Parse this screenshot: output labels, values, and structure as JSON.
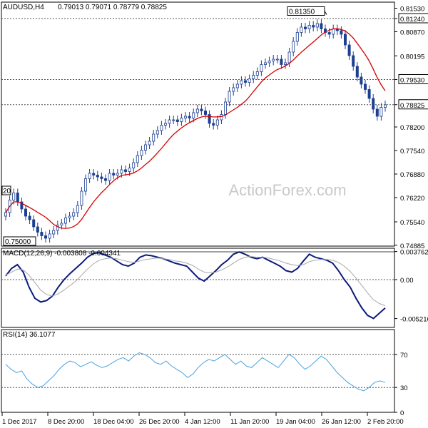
{
  "header": {
    "symbol": "AUDUSD,H4",
    "ohlc": "0.79013 0.79071 0.78779 0.78825"
  },
  "watermark": "ActionForex.com",
  "colors": {
    "candle": "#1d3f91",
    "ma": "#d60000",
    "macd": "#0b1b7a",
    "signal": "#a8a8a8",
    "rsi": "#4aa3df",
    "grid": "#c8c8c8",
    "level": "#555555"
  },
  "chart_data": [
    {
      "type": "candlestick",
      "title": "AUDUSD,H4",
      "ylim": [
        0.7486,
        0.817
      ],
      "yticks": [
        "0.81530",
        "0.81240",
        "0.80870",
        "0.80195",
        "0.79530",
        "0.78825",
        "0.78200",
        "0.77540",
        "0.76880",
        "0.76220",
        "0.75540",
        "0.74885"
      ],
      "xticks": [
        "1 Dec 2017",
        "8 Dec 20:00",
        "18 Dec 04:00",
        "26 Dec 20:00",
        "4 Jan 12:00",
        "11 Jan 20:00",
        "19 Jan 04:00",
        "26 Jan 12:00",
        "2 Feb 20:00"
      ],
      "levels": [
        0.8124,
        0.7953,
        0.78825
      ],
      "level_labels": [
        "0.81240",
        "0.79530",
        "0.78825"
      ],
      "annotations": [
        {
          "text": "0.81350",
          "value": 0.8135
        },
        {
          "text": "0.75000",
          "value": 0.75
        },
        {
          "text": "0.76420",
          "value": 0.7642
        }
      ],
      "annotation_visible_text": {
        "high": "0.81350",
        "low": "0.75000",
        "left": "20"
      },
      "series": [
        {
          "name": "price",
          "close": [
            0.758,
            0.7615,
            0.7635,
            0.761,
            0.759,
            0.757,
            0.756,
            0.754,
            0.7525,
            0.7515,
            0.7508,
            0.752,
            0.753,
            0.7545,
            0.755,
            0.7565,
            0.757,
            0.758,
            0.76,
            0.764,
            0.7675,
            0.769,
            0.7685,
            0.768,
            0.7675,
            0.767,
            0.769,
            0.7685,
            0.769,
            0.77,
            0.7695,
            0.7705,
            0.772,
            0.774,
            0.7755,
            0.777,
            0.778,
            0.78,
            0.781,
            0.7825,
            0.783,
            0.784,
            0.784,
            0.7835,
            0.7845,
            0.785,
            0.7845,
            0.786,
            0.787,
            0.7865,
            0.7855,
            0.783,
            0.7825,
            0.784,
            0.7855,
            0.789,
            0.792,
            0.793,
            0.794,
            0.795,
            0.7945,
            0.7955,
            0.7965,
            0.7975,
            0.7995,
            0.8,
            0.8005,
            0.801,
            0.801,
            0.7995,
            0.8,
            0.803,
            0.806,
            0.8085,
            0.81,
            0.8095,
            0.8105,
            0.81,
            0.811,
            0.8095,
            0.8085,
            0.808,
            0.8095,
            0.809,
            0.808,
            0.805,
            0.802,
            0.799,
            0.796,
            0.794,
            0.7925,
            0.79,
            0.787,
            0.785,
            0.7875,
            0.7882
          ]
        },
        {
          "name": "MA",
          "values": []
        }
      ]
    },
    {
      "type": "line",
      "title": "MACD(12,26,9) -0.003808 -0.004341",
      "ylim": [
        -0.0064,
        0.0042
      ],
      "yticks": [
        "0.003762",
        "0.00",
        "-0.005216"
      ],
      "series": [
        {
          "name": "MACD",
          "values": [
            0.0005,
            0.0015,
            0.002,
            0.001,
            -0.001,
            -0.0025,
            -0.003,
            -0.0028,
            -0.0022,
            -0.001,
            0.0,
            0.0008,
            0.0015,
            0.0022,
            0.003,
            0.0035,
            0.0036,
            0.0033,
            0.003,
            0.0025,
            0.002,
            0.0018,
            0.0022,
            0.003,
            0.0033,
            0.0032,
            0.003,
            0.0028,
            0.0025,
            0.0022,
            0.002,
            0.0018,
            0.001,
            0.0002,
            -0.0002,
            0.0005,
            0.0012,
            0.002,
            0.0026,
            0.0034,
            0.0037,
            0.0034,
            0.003,
            0.0028,
            0.003,
            0.0026,
            0.0022,
            0.0018,
            0.0012,
            0.001,
            0.0015,
            0.0025,
            0.0034,
            0.003,
            0.0028,
            0.0026,
            0.0022,
            0.0012,
            0.0,
            -0.001,
            -0.0025,
            -0.0038,
            -0.0048,
            -0.0052,
            -0.0045,
            -0.0038
          ]
        },
        {
          "name": "Signal",
          "values": [
            0.0006,
            0.001,
            0.0014,
            0.0013,
            0.0006,
            -0.0004,
            -0.0014,
            -0.002,
            -0.0022,
            -0.0019,
            -0.0014,
            -0.0008,
            -0.0002,
            0.0006,
            0.0014,
            0.0021,
            0.0026,
            0.0028,
            0.0029,
            0.0028,
            0.0026,
            0.0024,
            0.0023,
            0.0025,
            0.0027,
            0.0028,
            0.0029,
            0.0028,
            0.0027,
            0.0025,
            0.0024,
            0.0022,
            0.0019,
            0.0014,
            0.001,
            0.0009,
            0.001,
            0.0013,
            0.0017,
            0.0022,
            0.0027,
            0.003,
            0.0031,
            0.003,
            0.003,
            0.0029,
            0.0027,
            0.0025,
            0.0022,
            0.002,
            0.0019,
            0.002,
            0.0024,
            0.0026,
            0.0027,
            0.0027,
            0.0026,
            0.0023,
            0.0018,
            0.0011,
            0.0002,
            -0.0008,
            -0.0018,
            -0.0027,
            -0.0032,
            -0.0035
          ]
        }
      ]
    },
    {
      "type": "line",
      "title": "RSI(14) 36.1077",
      "ylim": [
        0,
        100
      ],
      "yticks": [
        "70",
        "30",
        "0"
      ],
      "levels": [
        70,
        30
      ],
      "series": [
        {
          "name": "RSI",
          "values": [
            58,
            52,
            48,
            50,
            40,
            34,
            30,
            32,
            38,
            44,
            52,
            58,
            62,
            60,
            55,
            58,
            61,
            57,
            54,
            56,
            60,
            64,
            66,
            62,
            68,
            72,
            70,
            66,
            60,
            58,
            62,
            56,
            52,
            48,
            42,
            46,
            54,
            60,
            64,
            62,
            66,
            70,
            64,
            58,
            62,
            56,
            54,
            60,
            66,
            62,
            58,
            54,
            62,
            70,
            66,
            58,
            52,
            56,
            62,
            68,
            64,
            56,
            48,
            42,
            36,
            32,
            28,
            26,
            30,
            36,
            38,
            36
          ]
        }
      ]
    }
  ]
}
